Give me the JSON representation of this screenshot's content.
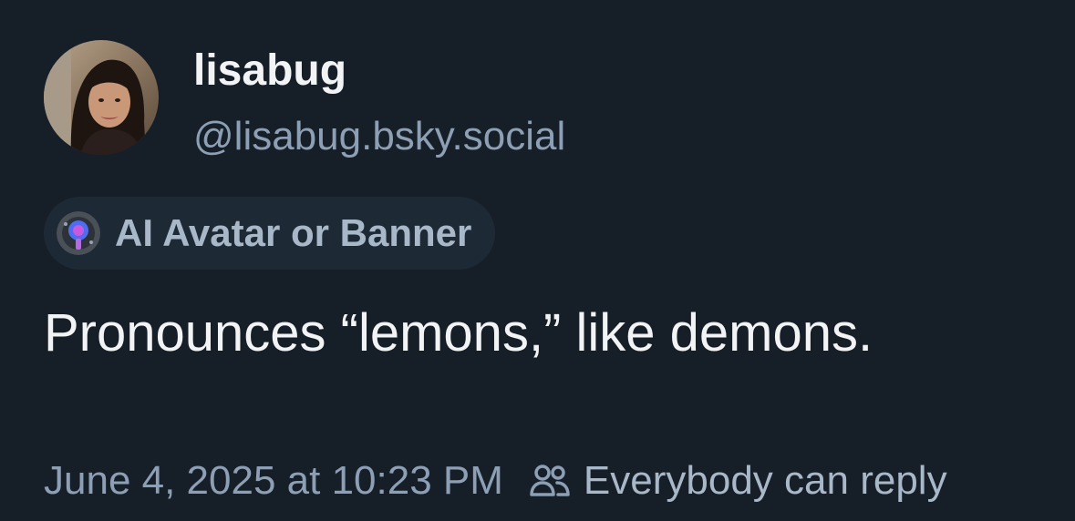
{
  "author": {
    "display_name": "lisabug",
    "handle": "@lisabug.bsky.social",
    "avatar_icon": "profile-photo"
  },
  "label": {
    "text": "AI Avatar or Banner",
    "icon": "labeler-icon"
  },
  "post": {
    "text": "Pronounces “lemons,” like demons."
  },
  "meta": {
    "timestamp": "June 4, 2025 at 10:23 PM",
    "reply_setting": "Everybody can reply",
    "reply_icon": "people-icon"
  },
  "colors": {
    "background": "#161e27",
    "primary_text": "#f1f3f5",
    "secondary_text": "#8c9fb4",
    "pill_background": "#1e2936"
  }
}
